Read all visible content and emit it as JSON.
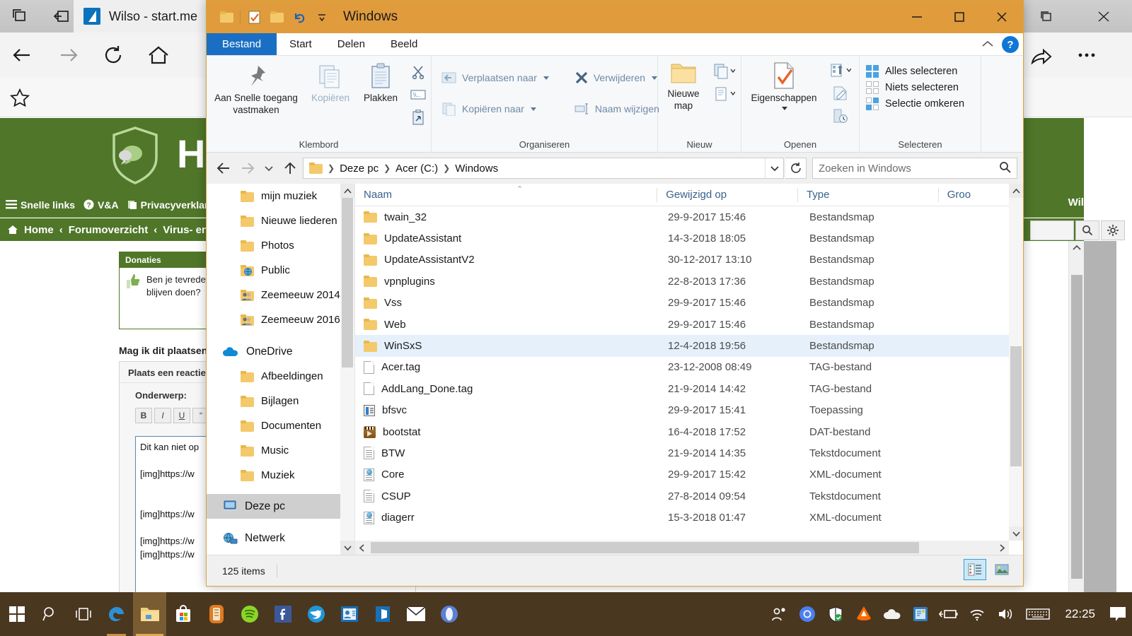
{
  "browser": {
    "tab_title": "Wilso - start.me",
    "icons": {
      "restore_window": "restore-window-icon",
      "set_aside": "set-aside-tabs-icon",
      "back": "back-arrow-icon",
      "forward": "forward-arrow-icon",
      "refresh": "refresh-icon",
      "home": "home-icon",
      "favorite": "star-icon",
      "share": "share-icon",
      "more": "more-options-icon",
      "minimize": "minimize-icon",
      "maximize": "maximize-icon",
      "close": "close-icon"
    }
  },
  "forum": {
    "title": "H",
    "user": "Wilsophie",
    "nav": [
      "Snelle links",
      "V&A",
      "Privacyverklaring"
    ],
    "breadcrumb": [
      "Home",
      "Forumoverzicht",
      "Virus- en ov"
    ],
    "donations_panel": {
      "header": "Donaties",
      "line1": "Ben je tevrede",
      "line2": "blijven doen?"
    },
    "topic_title": "Mag ik dit plaatsen",
    "reply_header": "Plaats een reactie",
    "subject_label": "Onderwerp:",
    "bbcodes": [
      "B",
      "I",
      "U"
    ],
    "textarea_lines": [
      "Dit kan niet op",
      "",
      "[img]https://w",
      "",
      "",
      "[img]https://w",
      "",
      "[img]https://w",
      "[img]https://w"
    ]
  },
  "explorer": {
    "title": "Windows",
    "quick_access_icons": [
      "folder-icon",
      "properties-check-icon",
      "new-folder-icon",
      "undo-icon",
      "customize-qat-icon"
    ],
    "window_buttons": [
      "minimize",
      "maximize",
      "close"
    ],
    "tabs": [
      {
        "label": "Bestand",
        "active_blue": true
      },
      {
        "label": "Start",
        "active_blue": false
      },
      {
        "label": "Delen",
        "active_blue": false
      },
      {
        "label": "Beeld",
        "active_blue": false
      }
    ],
    "help_label": "?",
    "ribbon": {
      "groups": [
        {
          "name": "Klembord",
          "big": [
            {
              "label": "Aan Snelle toegang vastmaken",
              "icon": "pin-icon",
              "dim": false
            },
            {
              "label": "Kopiëren",
              "icon": "copy-icon",
              "dim": true
            },
            {
              "label": "Plakken",
              "icon": "paste-icon",
              "dim": false
            }
          ],
          "small": [
            "cut-icon",
            "copy-path-icon",
            "paste-shortcut-icon"
          ]
        },
        {
          "name": "Organiseren",
          "items": [
            {
              "label": "Verplaatsen naar",
              "icon": "move-to-icon",
              "caret": true
            },
            {
              "label": "Kopiëren naar",
              "icon": "copy-to-icon",
              "caret": true
            },
            {
              "label": "Verwijderen",
              "icon": "delete-x-icon",
              "caret": true
            },
            {
              "label": "Naam wijzigen",
              "icon": "rename-icon",
              "caret": false
            }
          ]
        },
        {
          "name": "Nieuw",
          "big": [
            {
              "label": "Nieuwe map",
              "icon": "new-folder-big-icon"
            }
          ],
          "small": [
            "new-item-icon",
            "easy-access-icon"
          ]
        },
        {
          "name": "Openen",
          "big": [
            {
              "label": "Eigenschappen",
              "icon": "properties-icon",
              "caret": true
            }
          ],
          "small": [
            "open-with-icon",
            "edit-icon",
            "history-icon"
          ]
        },
        {
          "name": "Selecteren",
          "items": [
            {
              "label": "Alles selecteren",
              "icon": "select-all-icon"
            },
            {
              "label": "Niets selecteren",
              "icon": "select-none-icon"
            },
            {
              "label": "Selectie omkeren",
              "icon": "invert-selection-icon"
            }
          ]
        }
      ]
    },
    "address": {
      "back": "back-arrow-icon",
      "forward": "forward-arrow-icon",
      "recent": "recent-locations-icon",
      "up": "up-arrow-icon",
      "breadcrumb": [
        "Deze pc",
        "Acer (C:)",
        "Windows"
      ],
      "dropdown": "chevron-down-icon",
      "refresh": "refresh-icon"
    },
    "search": {
      "placeholder": "Zoeken in Windows",
      "icon": "search-icon"
    },
    "nav_pane": [
      {
        "label": "mijn muziek",
        "icon": "folder-icon",
        "indent": true,
        "selected": false
      },
      {
        "label": "Nieuwe liederen",
        "icon": "folder-icon",
        "indent": true,
        "selected": false
      },
      {
        "label": "Photos",
        "icon": "folder-icon",
        "indent": true,
        "selected": false
      },
      {
        "label": "Public",
        "icon": "shared-folder-icon",
        "indent": true,
        "selected": false
      },
      {
        "label": "Zeemeeuw 2014",
        "icon": "shared-users-folder-icon",
        "indent": true,
        "selected": false
      },
      {
        "label": "Zeemeeuw 2016",
        "icon": "shared-users-folder-icon",
        "indent": true,
        "selected": false
      },
      {
        "label": "OneDrive",
        "icon": "onedrive-cloud-icon",
        "indent": false,
        "selected": false
      },
      {
        "label": "Afbeeldingen",
        "icon": "folder-icon",
        "indent": true,
        "selected": false
      },
      {
        "label": "Bijlagen",
        "icon": "folder-icon",
        "indent": true,
        "selected": false
      },
      {
        "label": "Documenten",
        "icon": "folder-icon",
        "indent": true,
        "selected": false
      },
      {
        "label": "Music",
        "icon": "folder-icon",
        "indent": true,
        "selected": false
      },
      {
        "label": "Muziek",
        "icon": "folder-icon",
        "indent": true,
        "selected": false
      },
      {
        "label": "Deze pc",
        "icon": "this-pc-icon",
        "indent": false,
        "selected": true
      },
      {
        "label": "Netwerk",
        "icon": "network-icon",
        "indent": false,
        "selected": false
      }
    ],
    "columns": [
      "Naam",
      "Gewijzigd op",
      "Type",
      "Groo"
    ],
    "files": [
      {
        "name": "twain_32",
        "modified": "29-9-2017 15:46",
        "type": "Bestandsmap",
        "icon": "folder-icon",
        "selected": false
      },
      {
        "name": "UpdateAssistant",
        "modified": "14-3-2018 18:05",
        "type": "Bestandsmap",
        "icon": "folder-icon",
        "selected": false
      },
      {
        "name": "UpdateAssistantV2",
        "modified": "30-12-2017 13:10",
        "type": "Bestandsmap",
        "icon": "folder-icon",
        "selected": false
      },
      {
        "name": "vpnplugins",
        "modified": "22-8-2013 17:36",
        "type": "Bestandsmap",
        "icon": "folder-icon",
        "selected": false
      },
      {
        "name": "Vss",
        "modified": "29-9-2017 15:46",
        "type": "Bestandsmap",
        "icon": "folder-icon",
        "selected": false
      },
      {
        "name": "Web",
        "modified": "29-9-2017 15:46",
        "type": "Bestandsmap",
        "icon": "folder-icon",
        "selected": false
      },
      {
        "name": "WinSxS",
        "modified": "12-4-2018 19:56",
        "type": "Bestandsmap",
        "icon": "folder-icon",
        "selected": true
      },
      {
        "name": "Acer.tag",
        "modified": "23-12-2008 08:49",
        "type": "TAG-bestand",
        "icon": "blank-doc-icon",
        "selected": false
      },
      {
        "name": "AddLang_Done.tag",
        "modified": "21-9-2014 14:42",
        "type": "TAG-bestand",
        "icon": "blank-doc-icon",
        "selected": false
      },
      {
        "name": "bfsvc",
        "modified": "29-9-2017 15:41",
        "type": "Toepassing",
        "icon": "application-icon",
        "selected": false
      },
      {
        "name": "bootstat",
        "modified": "16-4-2018 17:52",
        "type": "DAT-bestand",
        "icon": "dat-file-icon",
        "selected": false
      },
      {
        "name": "BTW",
        "modified": "21-9-2014 14:35",
        "type": "Tekstdocument",
        "icon": "text-doc-icon",
        "selected": false
      },
      {
        "name": "Core",
        "modified": "29-9-2017 15:42",
        "type": "XML-document",
        "icon": "xml-doc-icon",
        "selected": false
      },
      {
        "name": "CSUP",
        "modified": "27-8-2014 09:54",
        "type": "Tekstdocument",
        "icon": "text-doc-icon",
        "selected": false
      },
      {
        "name": "diagerr",
        "modified": "15-3-2018 01:47",
        "type": "XML-document",
        "icon": "xml-doc-icon",
        "selected": false
      }
    ],
    "status": {
      "item_count": "125 items",
      "view_buttons": [
        "details-view-icon",
        "large-icons-view-icon"
      ]
    }
  },
  "taskbar": {
    "start": "windows-start-icon",
    "search": "search-icon",
    "task_view": "task-view-icon",
    "pinned": [
      {
        "name": "edge-icon"
      },
      {
        "name": "file-explorer-icon"
      },
      {
        "name": "microsoft-store-icon"
      },
      {
        "name": "orange-app-icon"
      },
      {
        "name": "spotify-icon"
      },
      {
        "name": "facebook-icon"
      },
      {
        "name": "blue-bird-app-icon"
      },
      {
        "name": "contacts-app-icon"
      },
      {
        "name": "office-icon"
      },
      {
        "name": "mail-icon"
      },
      {
        "name": "opera-icon"
      }
    ],
    "tray": [
      {
        "name": "people-icon"
      },
      {
        "name": "chrome-icon"
      },
      {
        "name": "windows-defender-icon"
      },
      {
        "name": "avast-icon"
      },
      {
        "name": "onedrive-tray-icon"
      },
      {
        "name": "intel-graphics-icon"
      },
      {
        "name": "battery-icon"
      },
      {
        "name": "wifi-icon"
      },
      {
        "name": "volume-icon"
      },
      {
        "name": "keyboard-icon"
      }
    ],
    "clock": "22:25",
    "action_center": "action-center-icon"
  }
}
